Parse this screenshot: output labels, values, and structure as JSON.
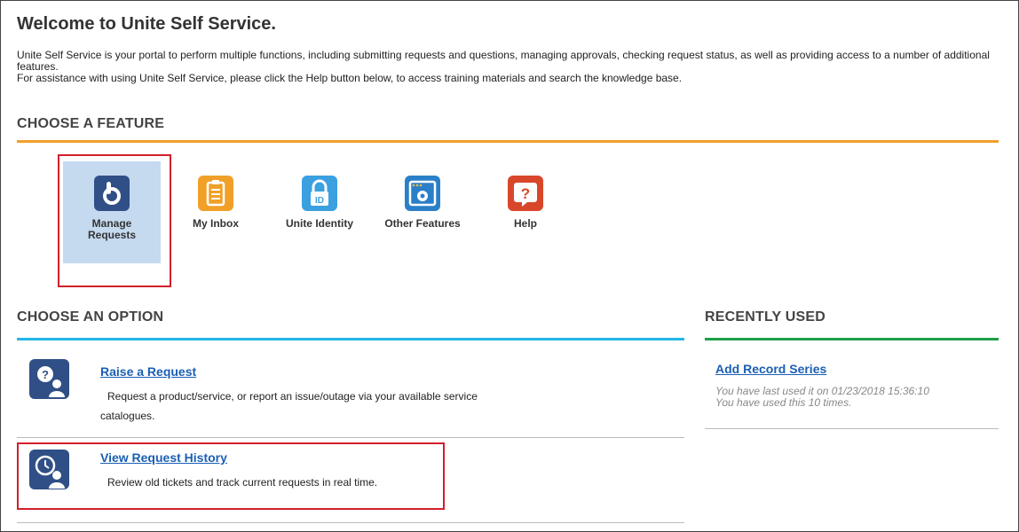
{
  "header": {
    "title": "Welcome to Unite Self Service.",
    "intro_line1": "Unite Self Service is your portal to perform multiple functions, including submitting requests and questions, managing approvals, checking request status, as well as providing access to a number of additional features.",
    "intro_line2": "For assistance with using Unite Self Service, please click the Help button below, to access training materials and search the knowledge base."
  },
  "features": {
    "heading": "CHOOSE A FEATURE",
    "accent": "#f0a028",
    "items": [
      {
        "line1": "Manage",
        "line2": "Requests",
        "icon": "manage-requests-icon",
        "color": "#2f4f86",
        "selected": true
      },
      {
        "line1": "My Inbox",
        "line2": "",
        "icon": "inbox-clipboard-icon",
        "color": "#f0a028",
        "selected": false
      },
      {
        "line1": "Unite Identity",
        "line2": "",
        "icon": "identity-lock-icon",
        "color": "#3aa0e0",
        "selected": false
      },
      {
        "line1": "Other Features",
        "line2": "",
        "icon": "other-features-gear-icon",
        "color": "#2a7fc8",
        "selected": false
      },
      {
        "line1": "Help",
        "line2": "",
        "icon": "help-question-icon",
        "color": "#d9472b",
        "selected": false
      }
    ]
  },
  "options": {
    "heading": "CHOOSE AN OPTION",
    "accent": "#22b7e6",
    "items": [
      {
        "title": "Raise a Request",
        "desc_line1": "Request a product/service, or report an issue/outage via your available service",
        "desc_line2": "catalogues.",
        "icon": "raise-request-icon"
      },
      {
        "title": "View Request History",
        "desc_line1": "Review old tickets and track current requests in real time.",
        "desc_line2": "",
        "icon": "request-history-icon"
      }
    ]
  },
  "recent": {
    "heading": "RECENTLY USED",
    "accent": "#1e9e4a",
    "item_title": "Add Record Series",
    "last_used": "You have last used it on 01/23/2018 15:36:10",
    "times_used": "You have used this 10 times."
  },
  "highlight_color": "#d0202a"
}
